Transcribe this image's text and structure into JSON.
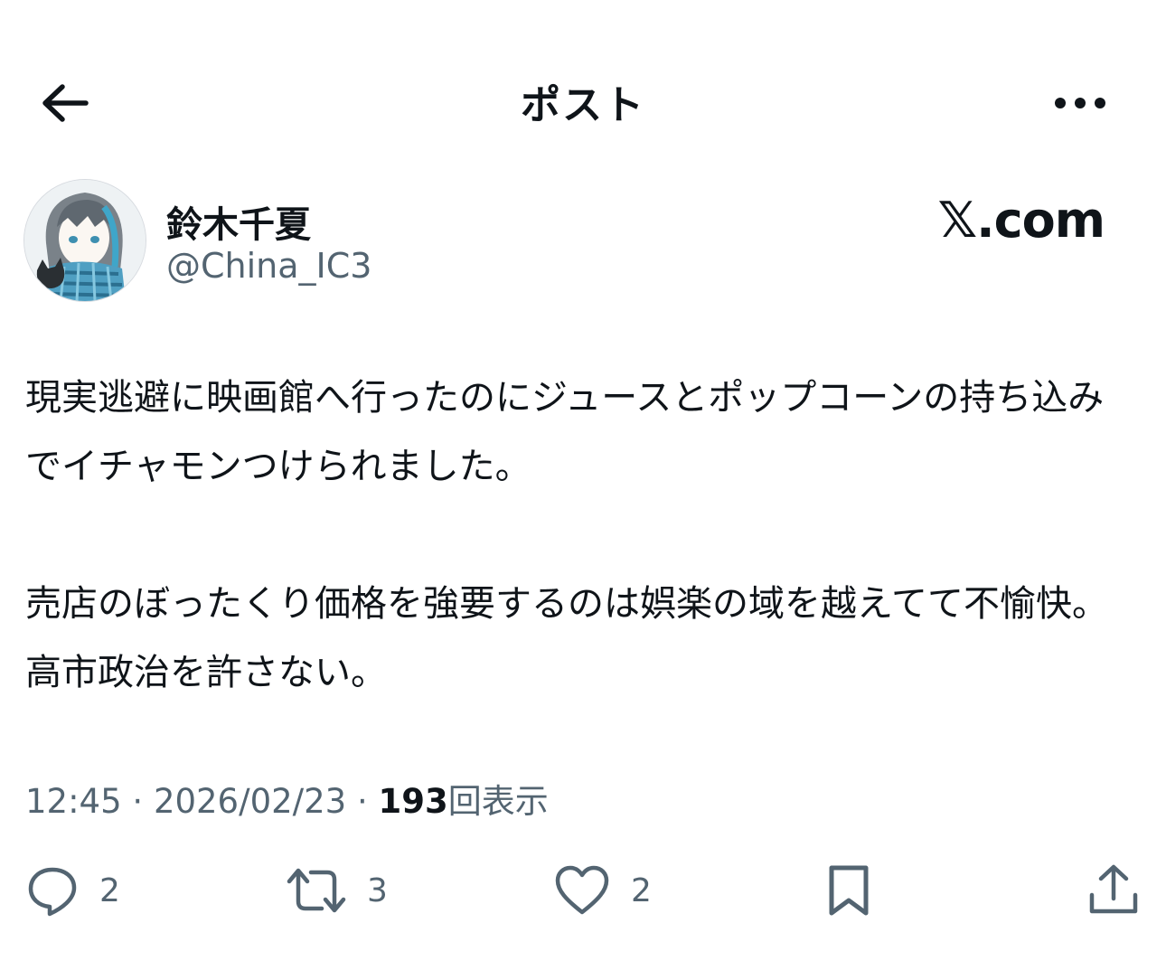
{
  "header": {
    "title": "ポスト"
  },
  "author": {
    "display_name": "鈴木千夏",
    "handle": "@China_IC3"
  },
  "brand": {
    "logo_text": "𝕏.com"
  },
  "post": {
    "paragraphs": [
      "現実逃避に映画館へ行ったのにジュースとポップコーンの持ち込みでイチャモンつけられました。",
      "売店のぼったくり価格を強要するのは娯楽の域を越えてて不愉快。高市政治を許さない。"
    ]
  },
  "meta": {
    "time": "12:45",
    "separator": " · ",
    "date": "2026/02/23",
    "views_count": "193",
    "views_label": "回表示"
  },
  "actions": {
    "reply_count": "2",
    "repost_count": "3",
    "like_count": "2"
  },
  "colors": {
    "text": "#0f1419",
    "secondary": "#536471",
    "background": "#ffffff"
  },
  "icons": {
    "back": "arrow-left-icon",
    "more": "more-horizontal-icon",
    "reply": "reply-icon",
    "repost": "repost-icon",
    "like": "heart-icon",
    "bookmark": "bookmark-icon",
    "share": "share-icon"
  }
}
